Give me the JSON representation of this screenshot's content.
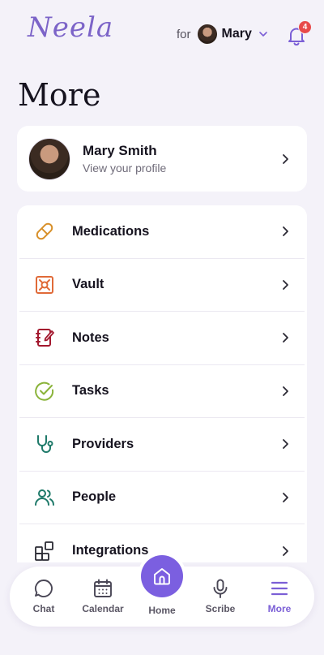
{
  "header": {
    "logo_text": "Neela",
    "for_label": "for",
    "selected_person": "Mary",
    "notification_count": "4"
  },
  "page": {
    "title": "More"
  },
  "profile": {
    "name": "Mary Smith",
    "subtitle": "View your profile"
  },
  "menu": {
    "items": [
      {
        "label": "Medications",
        "icon": "pill-icon",
        "color": "#d8902a"
      },
      {
        "label": "Vault",
        "icon": "vault-icon",
        "color": "#e06a38"
      },
      {
        "label": "Notes",
        "icon": "notebook-icon",
        "color": "#a3182e"
      },
      {
        "label": "Tasks",
        "icon": "check-circle-icon",
        "color": "#8ab33a"
      },
      {
        "label": "Providers",
        "icon": "stethoscope-icon",
        "color": "#1f7a6a"
      },
      {
        "label": "People",
        "icon": "people-icon",
        "color": "#1f7a6a"
      },
      {
        "label": "Integrations",
        "icon": "grid-plus-icon",
        "color": "#2a2a33"
      }
    ]
  },
  "tabbar": {
    "chat": "Chat",
    "calendar": "Calendar",
    "home": "Home",
    "scribe": "Scribe",
    "more": "More",
    "active_tab": "More",
    "accent": "#7b5fe0"
  }
}
